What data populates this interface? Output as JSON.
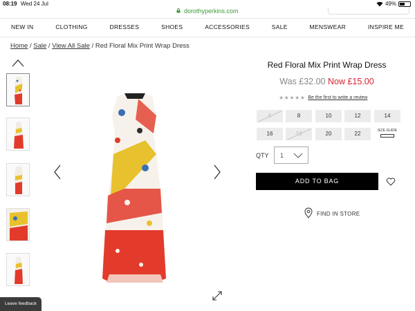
{
  "status_bar": {
    "time": "08:19",
    "date": "Wed 24 Jul",
    "battery": "49%",
    "battery_level": 0.49
  },
  "browser": {
    "url": "dorothyperkins.com"
  },
  "nav": {
    "items": [
      "NEW IN",
      "CLOTHING",
      "DRESSES",
      "SHOES",
      "ACCESSORIES",
      "SALE",
      "MENSWEAR",
      "INSPIRE ME"
    ]
  },
  "breadcrumb": {
    "home": "Home",
    "sale": "Sale",
    "view_all": "View All Sale",
    "current": "Red Floral Mix Print Wrap Dress",
    "separator": "/"
  },
  "product": {
    "title": "Red Floral Mix Print Wrap Dress",
    "was_price": "Was £32.00",
    "now_price": "Now £15.00",
    "rating_stars": 5,
    "review_link": "Be the first to write a review"
  },
  "sizes": [
    {
      "label": "6",
      "available": false
    },
    {
      "label": "8",
      "available": true
    },
    {
      "label": "10",
      "available": true
    },
    {
      "label": "12",
      "available": true
    },
    {
      "label": "14",
      "available": true
    },
    {
      "label": "16",
      "available": true
    },
    {
      "label": "18",
      "available": false
    },
    {
      "label": "20",
      "available": true
    },
    {
      "label": "22",
      "available": true
    }
  ],
  "size_guide_label": "SIZE GUIDE",
  "qty": {
    "label": "QTY",
    "value": "1"
  },
  "add_to_bag_label": "ADD TO BAG",
  "find_in_store_label": "FIND IN STORE",
  "feedback_label": "Leave feedback",
  "colors": {
    "accent_red": "#d4232f",
    "url_green": "#3a9a3a",
    "button_black": "#000000"
  }
}
